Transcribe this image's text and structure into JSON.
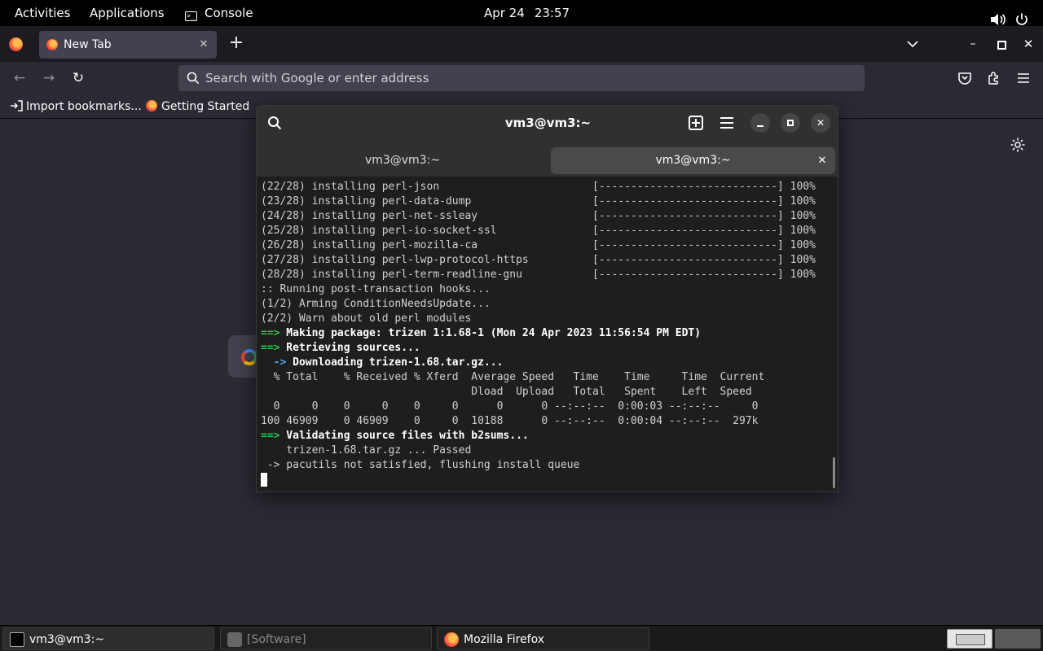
{
  "topbar": {
    "activities": "Activities",
    "applications": "Applications",
    "console": "Console",
    "date": "Apr 24",
    "time": "23:57"
  },
  "firefox": {
    "tab_title": "New Tab",
    "url_placeholder": "Search with Google or enter address",
    "bookmarks": [
      {
        "label": "Import bookmarks..."
      },
      {
        "label": "Getting Started"
      }
    ]
  },
  "terminal": {
    "title": "vm3@vm3:~",
    "tabs": [
      {
        "label": "vm3@vm3:~",
        "active": false
      },
      {
        "label": "vm3@vm3:~",
        "active": true
      }
    ],
    "lines": [
      {
        "kind": "plain",
        "text": "(22/28) installing perl-json                        [----------------------------] 100%"
      },
      {
        "kind": "plain",
        "text": "(23/28) installing perl-data-dump                   [----------------------------] 100%"
      },
      {
        "kind": "plain",
        "text": "(24/28) installing perl-net-ssleay                  [----------------------------] 100%"
      },
      {
        "kind": "plain",
        "text": "(25/28) installing perl-io-socket-ssl               [----------------------------] 100%"
      },
      {
        "kind": "plain",
        "text": "(26/28) installing perl-mozilla-ca                  [----------------------------] 100%"
      },
      {
        "kind": "plain",
        "text": "(27/28) installing perl-lwp-protocol-https          [----------------------------] 100%"
      },
      {
        "kind": "plain",
        "text": "(28/28) installing perl-term-readline-gnu           [----------------------------] 100%"
      },
      {
        "kind": "plain",
        "text": ":: Running post-transaction hooks..."
      },
      {
        "kind": "plain",
        "text": "(1/2) Arming ConditionNeedsUpdate..."
      },
      {
        "kind": "plain",
        "text": "(2/2) Warn about old perl modules"
      },
      {
        "kind": "arrow",
        "prefix": "==>",
        "text": " Making package: trizen 1:1.68-1 (Mon 24 Apr 2023 11:56:54 PM EDT)"
      },
      {
        "kind": "arrow",
        "prefix": "==>",
        "text": " Retrieving sources..."
      },
      {
        "kind": "sub",
        "prefix": "  ->",
        "text": " Downloading trizen-1.68.tar.gz..."
      },
      {
        "kind": "plain",
        "text": "  % Total    % Received % Xferd  Average Speed   Time    Time     Time  Current"
      },
      {
        "kind": "plain",
        "text": "                                 Dload  Upload   Total   Spent    Left  Speed"
      },
      {
        "kind": "plain",
        "text": "  0     0    0     0    0     0      0      0 --:--:--  0:00:03 --:--:--     0"
      },
      {
        "kind": "plain",
        "text": "100 46909    0 46909    0     0  10188      0 --:--:--  0:00:04 --:--:--  297k"
      },
      {
        "kind": "arrow",
        "prefix": "==>",
        "text": " Validating source files with b2sums..."
      },
      {
        "kind": "plain",
        "text": "    trizen-1.68.tar.gz ... Passed"
      },
      {
        "kind": "plain",
        "text": " -> pacutils not satisfied, flushing install queue"
      }
    ]
  },
  "taskbar": {
    "items": [
      {
        "label": "vm3@vm3:~"
      },
      {
        "label": "[Software]"
      },
      {
        "label": "Mozilla Firefox"
      }
    ]
  }
}
